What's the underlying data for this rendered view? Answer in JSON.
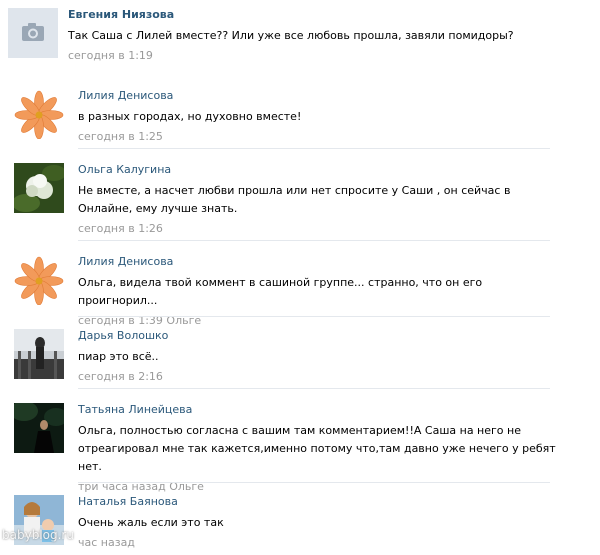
{
  "comments": [
    {
      "author": "Евгения Ниязова",
      "text": "Так Саша с Лилей вместе?? Или уже все любовь прошла, завяли помидоры?",
      "time": "сегодня в 1:19",
      "avatar": "camera-placeholder-icon"
    },
    {
      "author": "Лилия Денисова",
      "text": "в разных городах, но духовно вместе!",
      "time": "сегодня в 1:25",
      "avatar": "orange-flower-avatar"
    },
    {
      "author": "Ольга Калугина",
      "text": "Не вместе, а насчет любви прошла или нет спросите у Саши , он сейчас в Онлайне, ему лучше знать.",
      "time": "сегодня в 1:26",
      "avatar": "white-flower-avatar"
    },
    {
      "author": "Лилия Денисова",
      "text": "Ольга, видела твой коммент в сашиной группе... странно, что он его проигнорил...",
      "time": "сегодня в 1:39",
      "reply_to": "Ольге",
      "avatar": "orange-flower-avatar"
    },
    {
      "author": "Дарья Волошко",
      "text": "пиар это всё..",
      "time": "сегодня в 2:16",
      "avatar": "photo-avatar"
    },
    {
      "author": "Татьяна Линейцева",
      "text": "Ольга, полностью согласна с вашим там комментарием!!А Саша на него не отреагировал мне так кажется,именно потому что,там давно уже нечего у ребят нет.",
      "time": "три часа назад",
      "reply_to": "Ольге",
      "avatar": "photo-avatar"
    },
    {
      "author": "Наталья Баянова",
      "text": "Очень жаль если это так",
      "time": "час назад",
      "avatar": "photo-avatar"
    }
  ],
  "watermark": "babyblog.ru",
  "colors": {
    "link": "#2b587a",
    "meta": "#999999",
    "divider": "#e4e8ed"
  }
}
